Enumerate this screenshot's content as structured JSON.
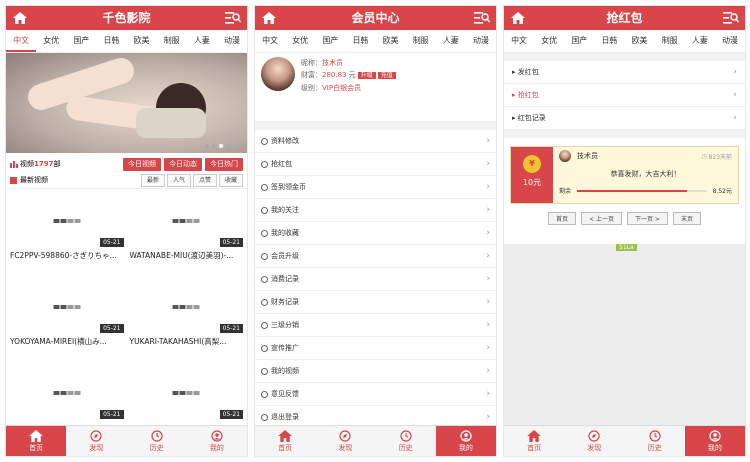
{
  "screens": [
    {
      "title": "千色影院",
      "tabs": [
        "中文",
        "女优",
        "国产",
        "日韩",
        "欧美",
        "制服",
        "人妻",
        "动漫"
      ],
      "stat_prefix": "视频",
      "stat_count": "1797",
      "stat_suffix": "部",
      "buttons": [
        "今日视频",
        "今日动态",
        "今日热门"
      ],
      "section_title": "最新视频",
      "sort_buttons": [
        "最新",
        "人气",
        "点赞",
        "收藏"
      ],
      "videos": [
        {
          "title": "FC2PPV-598860-さぎりちゃ...",
          "date": "05-21"
        },
        {
          "title": "WATANABE-MIU(渡辺美羽)-...",
          "date": "05-21"
        },
        {
          "title": "YOKOYAMA-MIREI(横山み...",
          "date": "05-21"
        },
        {
          "title": "YUKARI-TAKAHASHI(高梨...",
          "date": "05-21"
        },
        {
          "title": "",
          "date": "05-21"
        },
        {
          "title": "",
          "date": "05-21"
        }
      ]
    },
    {
      "title": "会员中心",
      "tabs": [
        "中文",
        "女优",
        "国产",
        "日韩",
        "欧美",
        "制服",
        "人妻",
        "动漫"
      ],
      "nick_label": "昵称：",
      "nick": "技术员",
      "money_label": "财富：",
      "money": "280.83",
      "money_unit": "元",
      "upgrade": "升级",
      "recharge": "充值",
      "level_label": "级别：",
      "level": "VIP白银会员",
      "menu": [
        "资料修改",
        "抢红包",
        "签到领金币",
        "我的关注",
        "我的收藏",
        "会员升级",
        "消费记录",
        "财务记录",
        "三级分销",
        "宣传推广",
        "我的视频",
        "意见反馈",
        "退出登录"
      ]
    },
    {
      "title": "抢红包",
      "tabs": [
        "中文",
        "女优",
        "国产",
        "日韩",
        "欧美",
        "制服",
        "人妻",
        "动漫"
      ],
      "menu": [
        "发红包",
        "抢红包",
        "红包记录"
      ],
      "envelope": {
        "amount": "10元",
        "user": "技术员",
        "time": "823天前",
        "message": "恭喜发财，大吉大利！",
        "remain_label": "剩余",
        "remain_value": "8.52元",
        "progress": 0.85
      },
      "pager": [
        "首页",
        "< 上一页",
        "下一页 >",
        "末页"
      ],
      "tag": "51La"
    }
  ],
  "footer": [
    "首页",
    "发现",
    "历史",
    "我的"
  ],
  "colors": {
    "accent": "#d9464a"
  }
}
